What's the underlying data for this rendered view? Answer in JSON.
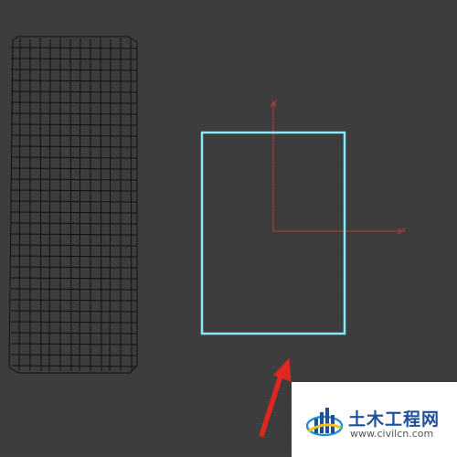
{
  "viewport": {
    "background": "#3c3c3c"
  },
  "objects": {
    "mesh_color": "#111111",
    "rectangle_shape_color": "#8be9f5",
    "gizmo_color": "#b43b3b",
    "arrow_color": "#e0261e"
  },
  "gizmo": {
    "x_label": "x",
    "y_label": "y"
  },
  "watermark": {
    "brand_name": "土木工程网",
    "url": "www.civilcn.com",
    "logo_icon": "building-bars-icon"
  }
}
